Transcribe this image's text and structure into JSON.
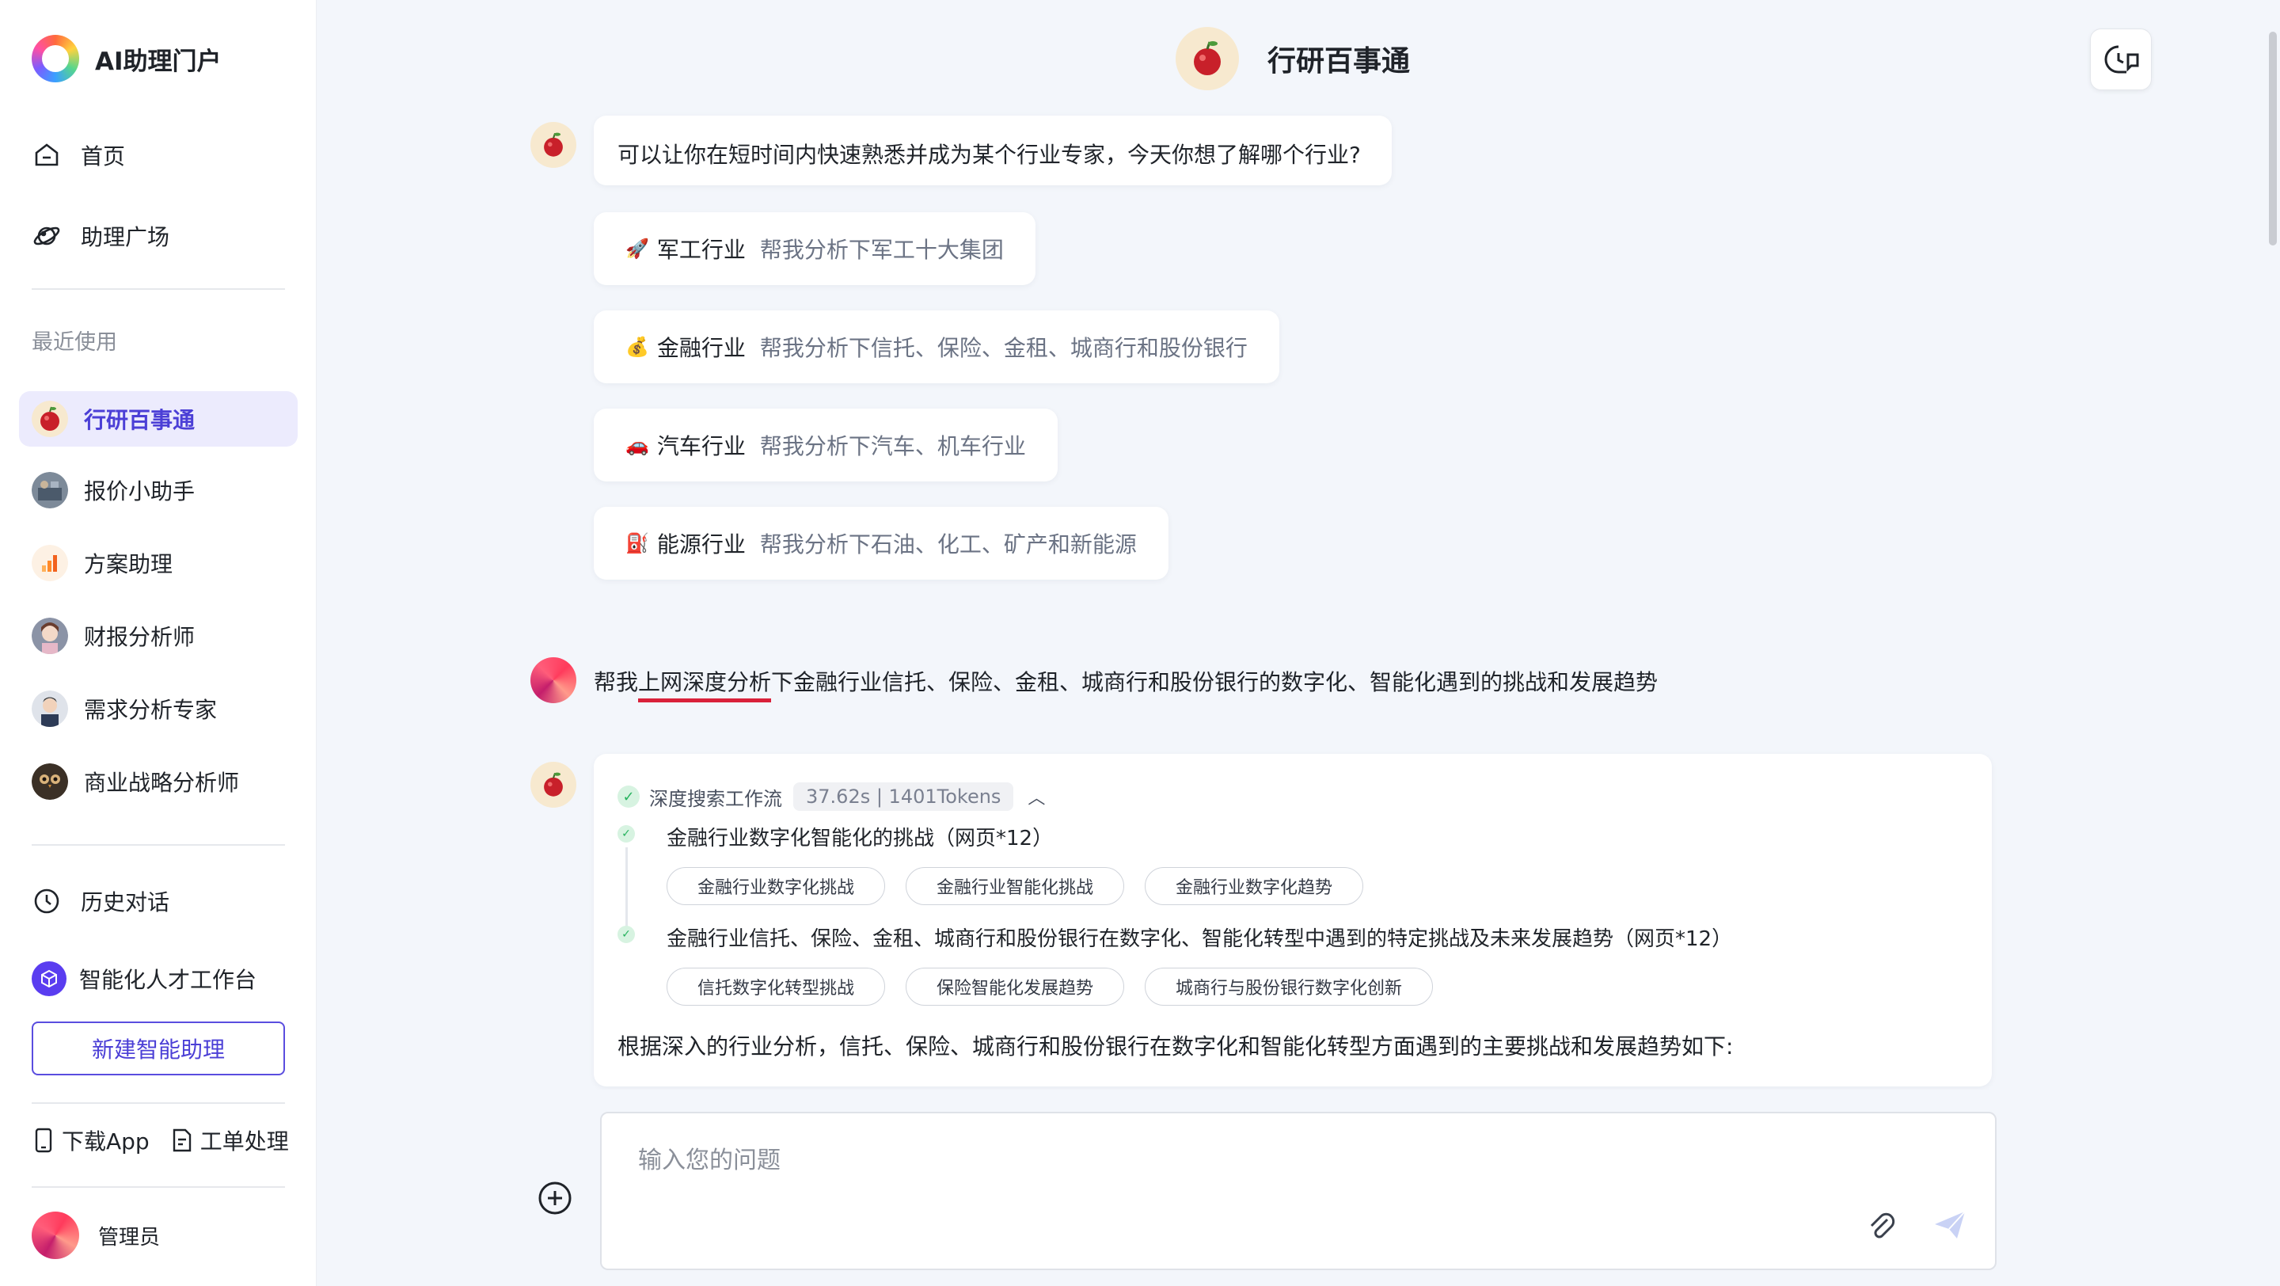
{
  "sidebar": {
    "brand": "AI助理门户",
    "nav": [
      {
        "label": "首页",
        "icon": "home-icon"
      },
      {
        "label": "助理广场",
        "icon": "planet-icon"
      }
    ],
    "recent_label": "最近使用",
    "recent": [
      {
        "label": "行研百事通",
        "active": true
      },
      {
        "label": "报价小助手"
      },
      {
        "label": "方案助理"
      },
      {
        "label": "财报分析师"
      },
      {
        "label": "需求分析专家"
      },
      {
        "label": "商业战略分析师"
      }
    ],
    "history": "历史对话",
    "talent": "智能化人才工作台",
    "new_assistant": "新建智能助理",
    "download_app": "下载App",
    "ticket": "工单处理",
    "admin": "管理员"
  },
  "header": {
    "title": "行研百事通"
  },
  "chat": {
    "intro": "可以让你在短时间内快速熟悉并成为某个行业专家，今天你想了解哪个行业?",
    "suggestions": [
      {
        "emoji": "🚀",
        "category": "军工行业",
        "hint": "帮我分析下军工十大集团"
      },
      {
        "emoji": "💰",
        "category": "金融行业",
        "hint": "帮我分析下信托、保险、金租、城商行和股份银行"
      },
      {
        "emoji": "🚗",
        "category": "汽车行业",
        "hint": "帮我分析下汽车、机车行业"
      },
      {
        "emoji": "⛽",
        "category": "能源行业",
        "hint": "帮我分析下石油、化工、矿产和新能源"
      }
    ],
    "user_message": {
      "before": "帮我",
      "underlined": "上网深度分析",
      "after": "下金融行业信托、保险、金租、城商行和股份银行的数字化、智能化遇到的挑战和发展趋势"
    },
    "workflow": {
      "title": "深度搜索工作流",
      "meta": "37.62s | 1401Tokens",
      "steps": [
        {
          "query": "金融行业数字化智能化的挑战（网页*12）",
          "tags": [
            "金融行业数字化挑战",
            "金融行业智能化挑战",
            "金融行业数字化趋势"
          ]
        },
        {
          "query": "金融行业信托、保险、金租、城商行和股份银行在数字化、智能化转型中遇到的特定挑战及未来发展趋势（网页*12）",
          "tags": [
            "信托数字化转型挑战",
            "保险智能化发展趋势",
            "城商行与股份银行数字化创新"
          ]
        }
      ],
      "summary": "根据深入的行业分析，信托、保险、城商行和股份银行在数字化和智能化转型方面遇到的主要挑战和发展趋势如下:"
    }
  },
  "composer": {
    "placeholder": "输入您的问题"
  },
  "colors": {
    "accent": "#4b3fd6",
    "active_bg": "#ecebfd",
    "check_green": "#27b35f",
    "underline_red": "#d9213a"
  }
}
